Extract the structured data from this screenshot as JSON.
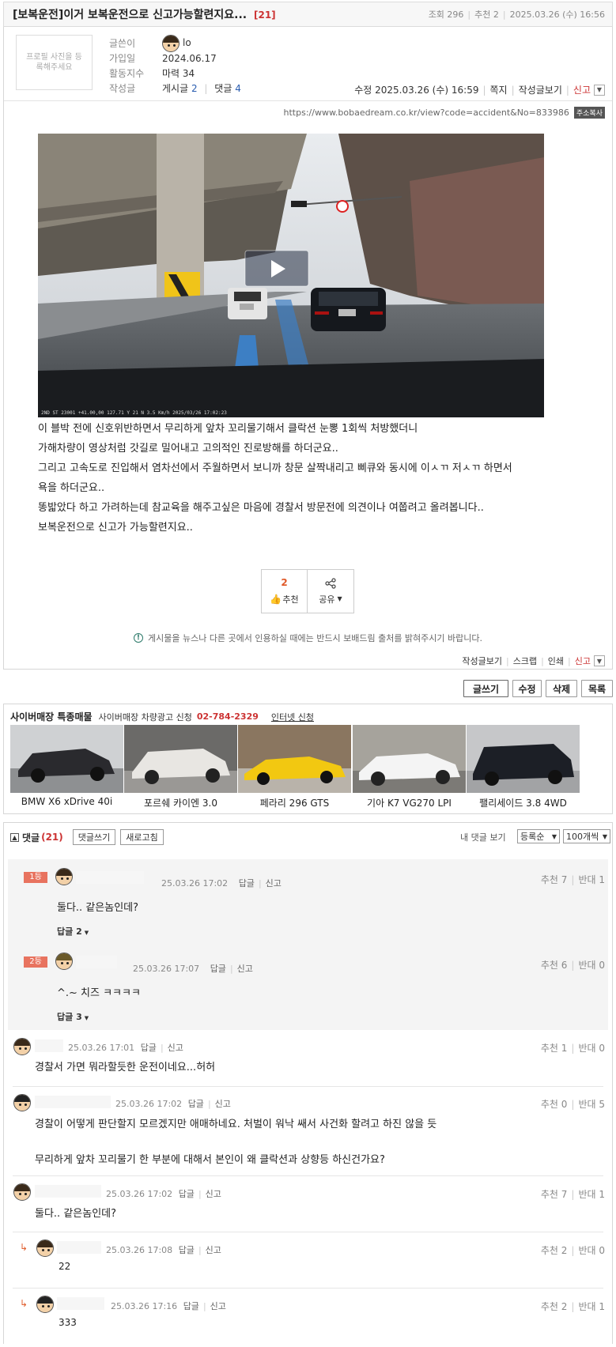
{
  "post": {
    "category": "[보복운전]",
    "title": "이거 보복운전으로 신고가능할련지요...",
    "comment_count": "[21]",
    "views": "조회 296",
    "recommends": "추천 2",
    "date": "2025.03.26 (수) 16:56"
  },
  "author": {
    "photo_placeholder": "프로필 사진을 등록해주세요",
    "labels": [
      "글쓴이",
      "가입일",
      "활동지수",
      "작성글"
    ],
    "name": "lo",
    "joined": "2024.06.17",
    "activity": "마력 34",
    "posts_label": "게시글",
    "posts_count": "2",
    "comments_label": "댓글",
    "comments_count": "4"
  },
  "post_tools": {
    "edited": "수정 2025.03.26 (수) 16:59",
    "message": "쪽지",
    "view_author_posts": "작성글보기",
    "report": "신고"
  },
  "url": {
    "text": "https://www.bobaedream.co.kr/view?code=accident&No=833986",
    "copy_button": "주소복사"
  },
  "video": {
    "overlay_text": "2ND ST 23001 +41.00,00 127.71 Y 21 N 3.5 Km/h 2025/03/26 17:02:23"
  },
  "body_lines": [
    "이 블박 전에 신호위반하면서 무리하게 앞차 꼬리물기해서 클락션 눈뽕 1회씩 처방했더니",
    "가해차량이 영상처럼 갓길로 밀어내고 고의적인 진로방해를 하더군요..",
    "그리고 고속도로 진입해서 염차선에서 주월하면서 보니까 창문 살짝내리고 삐큐와 동시에 이ㅅㄲ 저ㅅㄲ 하면서",
    "욕을 하더군요..",
    "똥밟았다 하고 가려하는데 참교육을 해주고싶은 마음에 경찰서 방문전에 의견이나 여쭙려고 올려봅니다..",
    "보복운전으로 신고가 가능할련지요.."
  ],
  "actions": {
    "recommend_count": "2",
    "recommend_label": "추천",
    "share_label": "공유"
  },
  "notice": "게시물을 뉴스나 다른 곳에서 인용하실 때에는 반드시 보배드림 출처를 밝혀주시기 바랍니다.",
  "footer_tools": {
    "view_posts": "작성글보기",
    "scrap": "스크랩",
    "print": "인쇄",
    "report": "신고"
  },
  "board_buttons": {
    "write": "글쓰기",
    "edit": "수정",
    "delete": "삭제",
    "list": "목록"
  },
  "cyber": {
    "title": "사이버매장 특종매물",
    "ad_label": "사이버매장 차량광고 신청",
    "phone": "02-784-2329",
    "internet_apply": "인터넷 신청",
    "cars": [
      {
        "name": "BMW X6 xDrive 40i",
        "color": "#2a2a2e"
      },
      {
        "name": "포르쉐 카이엔 3.0",
        "color": "#e8e6e2"
      },
      {
        "name": "페라리 296 GTS",
        "color": "#f2c811"
      },
      {
        "name": "기아 K7 VG270 LPI",
        "color": "#f4f4f4"
      },
      {
        "name": "팰리세이드 3.8 4WD",
        "color": "#1c1f26"
      }
    ]
  },
  "comments_header": {
    "label": "댓글",
    "count": "(21)",
    "write": "댓글쓰기",
    "refresh": "새로고침",
    "my_comments": "내 댓글 보기",
    "sort": "등록순",
    "per_page": "100개씩"
  },
  "best": [
    {
      "rank": "1등",
      "date": "25.03.26 17:02",
      "reply": "답글",
      "report": "신고",
      "up": "추천 7",
      "down": "반대 1",
      "text": "둘다.. 같은놈인데?",
      "replies": "답글 2"
    },
    {
      "rank": "2등",
      "date": "25.03.26 17:07",
      "reply": "답글",
      "report": "신고",
      "up": "추천 6",
      "down": "반대 0",
      "text": "^.~ 치즈 ㅋㅋㅋㅋ",
      "replies": "답글 3"
    }
  ],
  "comments": [
    {
      "date": "25.03.26 17:01",
      "reply": "답글",
      "report": "신고",
      "up": "추천 1",
      "down": "반대 0",
      "text": "경찰서 가면 뭐라할듯한 운전이네요...허허"
    },
    {
      "date": "25.03.26 17:02",
      "reply": "답글",
      "report": "신고",
      "up": "추천 0",
      "down": "반대 5",
      "text": "경찰이 어떻게 판단할지 모르겠지만 애매하네요. 처벌이 워낙 쌔서 사건화 할려고 하진 않을 듯",
      "text2": "무리하게 앞차 꼬리물기 한 부분에 대해서 본인이 왜 클락션과 상향등 하신건가요?"
    },
    {
      "date": "25.03.26 17:02",
      "reply": "답글",
      "report": "신고",
      "up": "추천 7",
      "down": "반대 1",
      "text": "둘다.. 같은놈인데?"
    },
    {
      "date": "25.03.26 17:08",
      "reply": "답글",
      "report": "신고",
      "up": "추천 2",
      "down": "반대 0",
      "text": "22"
    },
    {
      "date": "25.03.26 17:16",
      "reply": "답글",
      "report": "신고",
      "up": "추천 2",
      "down": "반대 1",
      "text": "333"
    }
  ]
}
